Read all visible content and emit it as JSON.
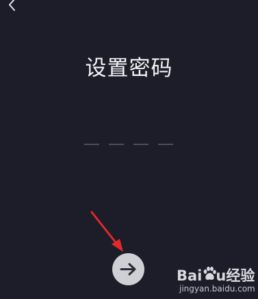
{
  "header": {
    "back_icon": "chevron-left-icon"
  },
  "page": {
    "title": "设置密码"
  },
  "pin": {
    "slot_count": 4,
    "filled": 0
  },
  "actions": {
    "next_icon": "arrow-right-icon"
  },
  "watermark": {
    "brand_prefix": "Bai",
    "brand_suffix": "u经验",
    "url": "jingyan.baidu.com"
  },
  "colors": {
    "background": "#1c1d29",
    "title_text": "#f4f4f6",
    "pin_slot": "#4d4f5c",
    "next_button": "#cfd0d4",
    "next_arrow": "#2a2b36",
    "annotation_arrow": "#e02a2a"
  }
}
